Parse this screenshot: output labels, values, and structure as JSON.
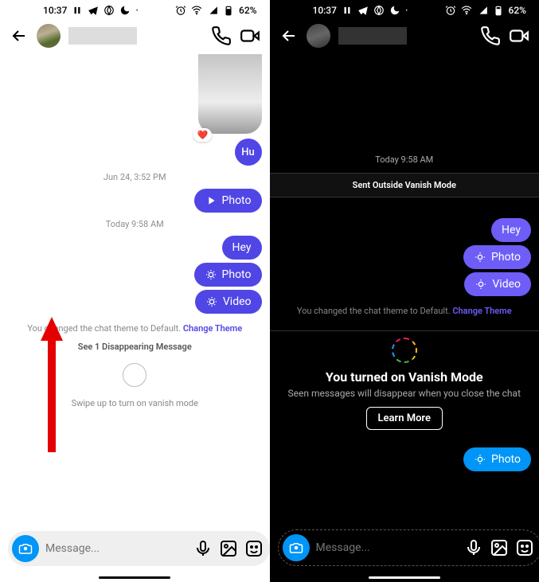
{
  "status": {
    "time": "10:37",
    "battery": "62%"
  },
  "left": {
    "msg_hu": "Hu",
    "ts1": "Jun 24, 3:52 PM",
    "photo_label": "Photo",
    "ts2": "Today 9:58 AM",
    "hey": "Hey",
    "photo2": "Photo",
    "video": "Video",
    "theme_text": "You changed the chat theme to Default.",
    "theme_link": "Change Theme",
    "disappearing": "See 1 Disappearing Message",
    "swipe_hint": "Swipe up to turn on vanish mode",
    "placeholder": "Message..."
  },
  "right": {
    "ts": "Today 9:58 AM",
    "outside_label": "Sent Outside Vanish Mode",
    "hey": "Hey",
    "photo": "Photo",
    "video": "Video",
    "theme_text": "You changed the chat theme to Default.",
    "theme_link": "Change Theme",
    "vanish_title": "You turned on Vanish Mode",
    "vanish_sub": "Seen messages will disappear when you close the chat",
    "learn_more": "Learn More",
    "photo_blue": "Photo",
    "placeholder": "Message..."
  }
}
